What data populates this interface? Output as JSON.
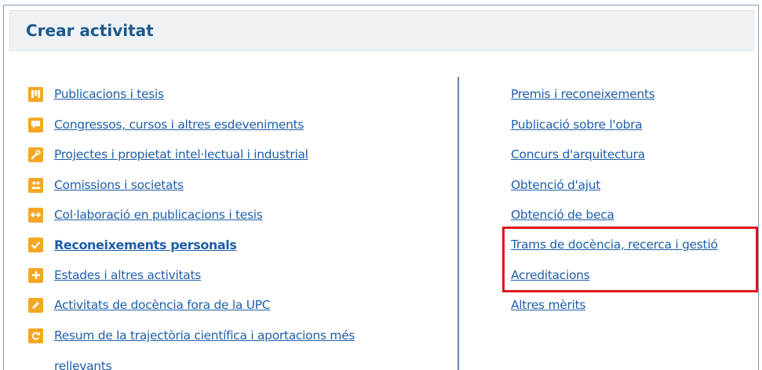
{
  "panel": {
    "title": "Crear activitat"
  },
  "left_items": [
    {
      "label": "Publicacions i tesis",
      "icon": "book-icon",
      "bold": false
    },
    {
      "label": "Congressos, cursos i altres esdeveniments",
      "icon": "speech-bubble-icon",
      "bold": false
    },
    {
      "label": "Projectes i propietat intel·lectual i industrial",
      "icon": "wrench-icon",
      "bold": false
    },
    {
      "label": "Comissions i societats",
      "icon": "people-icon",
      "bold": false
    },
    {
      "label": "Col·laboració en publicacions i tesis",
      "icon": "arrows-icon",
      "bold": false
    },
    {
      "label": "Reconeixements personals",
      "icon": "check-icon",
      "bold": true
    },
    {
      "label": "Estades i altres activitats",
      "icon": "plus-icon",
      "bold": false
    },
    {
      "label": "Activitats de docència fora de la UPC",
      "icon": "pencil-icon",
      "bold": false
    },
    {
      "label": "Resum de la trajectòria científica i aportacions més",
      "label_line2": "rellevants",
      "icon": "refresh-icon",
      "bold": false
    }
  ],
  "right_items": [
    {
      "label": "Premis i reconeixements"
    },
    {
      "label": "Publicació sobre l'obra"
    },
    {
      "label": "Concurs d'arquitectura"
    },
    {
      "label": "Obtenció d'ajut"
    },
    {
      "label": "Obtenció de beca"
    },
    {
      "label": "Trams de docència, recerca i gestió"
    },
    {
      "label": "Acreditacions"
    },
    {
      "label": "Altres mèrits"
    }
  ],
  "colors": {
    "icon": "#f5a623",
    "link": "#1f5fa8",
    "title": "#1d5a8e",
    "highlight": "#e0141e"
  }
}
